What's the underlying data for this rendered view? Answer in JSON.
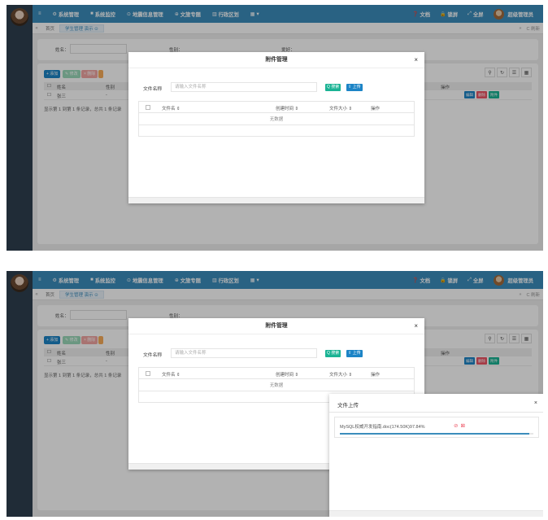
{
  "nav": {
    "items": [
      {
        "icon": "menu-icon",
        "glyph": "≡",
        "label": ""
      },
      {
        "icon": "gear-icon",
        "glyph": "⚙",
        "label": "系统管理"
      },
      {
        "icon": "monitor-icon",
        "glyph": "■",
        "label": "系统监控"
      },
      {
        "icon": "map-pin-icon",
        "glyph": "⊙",
        "label": "地震信息管理"
      },
      {
        "icon": "globe-icon",
        "glyph": "⊕",
        "label": "文旅专题"
      },
      {
        "icon": "building-icon",
        "glyph": "▥",
        "label": "行政区划"
      },
      {
        "icon": "grid-icon",
        "glyph": "▦",
        "label": "▾"
      }
    ],
    "right": {
      "docs": "文档",
      "lock": "锁屏",
      "fullscreen": "全屏",
      "user": "超级管理员"
    }
  },
  "tabs": {
    "home": "首页",
    "active": "学生管理 演示 ⊙",
    "refresh": "C 刷新"
  },
  "search": {
    "name_label": "姓名：",
    "gender_label": "性别：",
    "hobby_label": "爱好："
  },
  "toolbar": {
    "add": "+ 添加",
    "edit": "✎ 修改",
    "delete": "× 删除"
  },
  "grid": {
    "headers": {
      "name": "姓名",
      "gender": "性别",
      "operation": "操作"
    },
    "row": {
      "name": "张三",
      "gender": "-"
    },
    "row_actions": [
      "编辑",
      "删除",
      "附件"
    ],
    "page_info": "显示第 1 到第 1 条记录，总共 1 条记录"
  },
  "attach_modal": {
    "title": "附件管理",
    "file_label": "文件名称",
    "file_placeholder": "请输入文件名称",
    "search_btn": "Q 搜索",
    "upload_btn": "⇪ 上传",
    "columns": {
      "name": "文件名 ⇕",
      "created": "创建时间 ⇕",
      "size": "文件大小 ⇕",
      "operation": "操作"
    },
    "empty": "无数据",
    "close": "×"
  },
  "upload_dialog": {
    "title": "文件上传",
    "close": "×",
    "file_text": "MySQL权威开发指南.doc(174.50K)97.84%",
    "progress_percent": 97.84,
    "icons": [
      "pause-icon",
      "cancel-icon"
    ]
  },
  "colors": {
    "topbar": "#3c8dbc",
    "sidebar": "#2f4050",
    "primary": "#1c84c6",
    "success": "#1ab394",
    "danger": "#ed5565",
    "warning": "#f8ac59"
  }
}
